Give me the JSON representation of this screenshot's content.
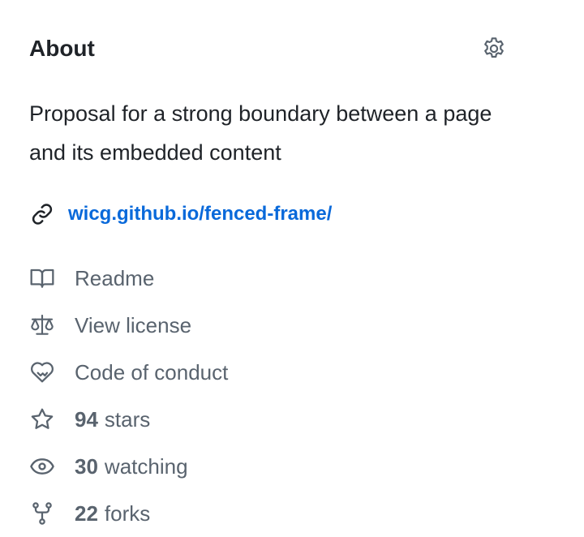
{
  "about": {
    "title": "About",
    "settings_icon": "gear-icon",
    "description": "Proposal for a strong boundary between a page and its embedded content",
    "website": {
      "icon": "link-icon",
      "text": "wicg.github.io/fenced-frame/"
    },
    "links": {
      "readme": {
        "icon": "book-icon",
        "label": "Readme"
      },
      "license": {
        "icon": "law-icon",
        "label": "View license"
      },
      "conduct": {
        "icon": "code-of-conduct-icon",
        "label": "Code of conduct"
      },
      "stars": {
        "icon": "star-icon",
        "count": "94",
        "label": "stars"
      },
      "watching": {
        "icon": "eye-icon",
        "count": "30",
        "label": "watching"
      },
      "forks": {
        "icon": "repo-forked-icon",
        "count": "22",
        "label": "forks"
      }
    }
  },
  "colors": {
    "text": "#1f2328",
    "muted": "#59636e",
    "link": "#0969da"
  }
}
